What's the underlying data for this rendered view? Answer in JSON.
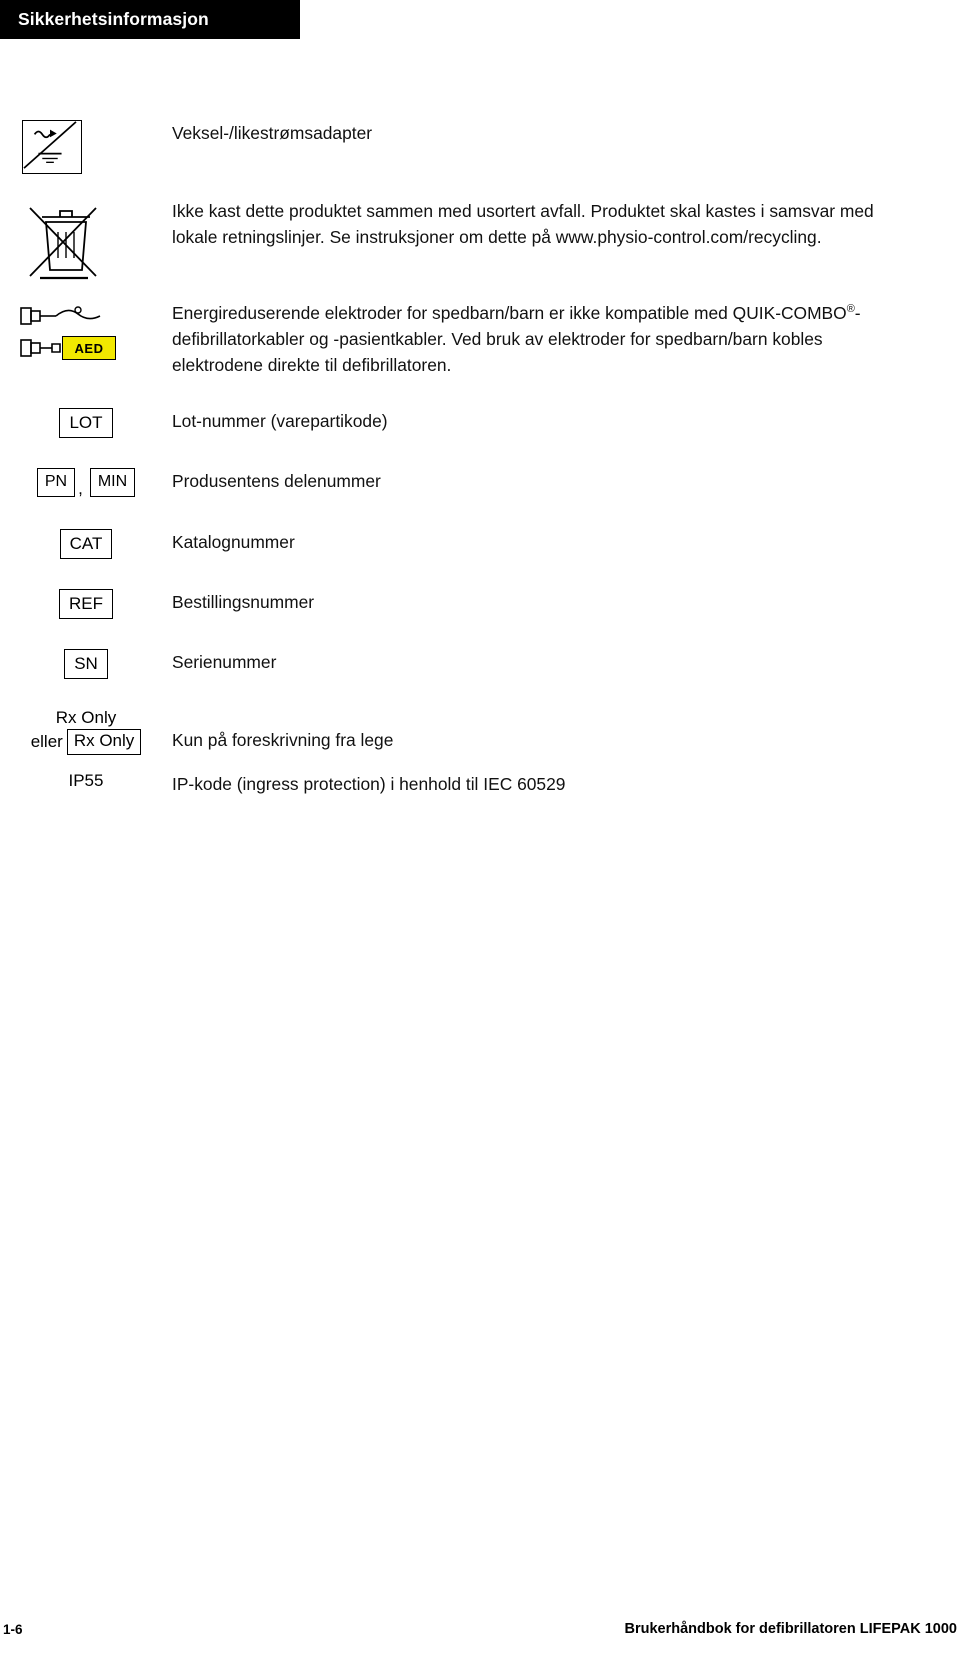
{
  "header": {
    "title": "Sikkerhetsinformasjon"
  },
  "rows": [
    {
      "symbol_name": "ac-dc-adapter-icon",
      "description": "Veksel-/likestrømsadapter"
    },
    {
      "symbol_name": "weee-crossed-out-bin-icon",
      "description": "Ikke kast dette produktet sammen med usortert avfall. Produktet skal kastes i samsvar med lokale retningslinjer. Se instruksjoner om dette på www.physio-control.com/recycling."
    },
    {
      "symbol_name": "pediatric-electrodes-aed-icon",
      "aed_label": "AED",
      "description_part1": "Energireduserende elektroder for spedbarn/barn er ikke kompatible med QUIK-COMBO",
      "description_reg": "®",
      "description_part2": "-defibrillatorkabler og -pasientkabler. Ved bruk av elektroder for spedbarn/barn kobles elektrodene direkte til defibrillatoren."
    },
    {
      "symbol_name": "lot-label",
      "symbol_text": "LOT",
      "description": "Lot-nummer (varepartikode)"
    },
    {
      "symbol_name": "pn-min-label",
      "symbol_text_1": "PN",
      "symbol_separator": ",",
      "symbol_text_2": "MIN",
      "description": "Produsentens delenummer"
    },
    {
      "symbol_name": "cat-label",
      "symbol_text": "CAT",
      "description": "Katalognummer"
    },
    {
      "symbol_name": "ref-label",
      "symbol_text": "REF",
      "description": "Bestillingsnummer"
    },
    {
      "symbol_name": "sn-label",
      "symbol_text": "SN",
      "description": "Serienummer"
    },
    {
      "symbol_name": "rx-only-label",
      "rx_line1": "Rx Only",
      "rx_eller": "eller",
      "rx_boxed": "Rx Only",
      "description": "Kun på foreskrivning fra lege"
    },
    {
      "symbol_name": "ip-rating-label",
      "symbol_text": "IP55",
      "description": "IP-kode (ingress protection) i henhold til IEC 60529"
    }
  ],
  "footer": {
    "page_number": "1-6",
    "document_title": "Brukerhåndbok for defibrillatoren LIFEPAK 1000"
  },
  "colors": {
    "header_bg": "#000000",
    "header_text": "#ffffff",
    "aed_badge_bg": "#f2e800",
    "body_text": "#111111"
  }
}
